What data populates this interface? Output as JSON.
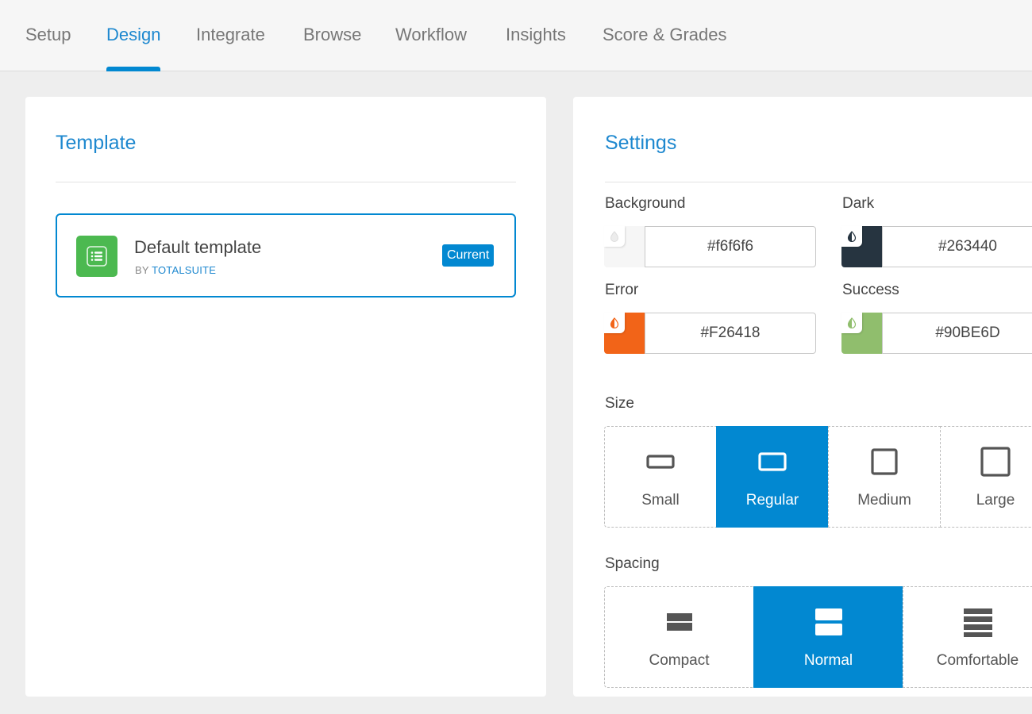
{
  "nav": {
    "tabs": [
      {
        "label": "Setup"
      },
      {
        "label": "Design"
      },
      {
        "label": "Integrate"
      },
      {
        "label": "Browse"
      },
      {
        "label": "Workflow"
      },
      {
        "label": "Insights"
      },
      {
        "label": "Score & Grades"
      }
    ],
    "active": "Design"
  },
  "template_panel": {
    "title": "Template",
    "card": {
      "name": "Default template",
      "by_prefix": "BY",
      "author": "TOTALSUITE",
      "badge": "Current",
      "icon": "list-icon",
      "icon_color": "#4cb950"
    }
  },
  "settings_panel": {
    "title": "Settings",
    "colors": [
      {
        "label": "Background",
        "value": "#f6f6f6",
        "swatch": "#f6f6f6"
      },
      {
        "label": "Dark",
        "value": "#263440",
        "swatch": "#263440"
      },
      {
        "label": "Error",
        "value": "#F26418",
        "swatch": "#F26418"
      },
      {
        "label": "Success",
        "value": "#90BE6D",
        "swatch": "#90BE6D"
      }
    ],
    "size": {
      "label": "Size",
      "options": [
        "Small",
        "Regular",
        "Medium",
        "Large"
      ],
      "selected": "Regular"
    },
    "spacing": {
      "label": "Spacing",
      "options": [
        "Compact",
        "Normal",
        "Comfortable"
      ],
      "selected": "Normal"
    }
  },
  "accent_color": "#0288d1"
}
